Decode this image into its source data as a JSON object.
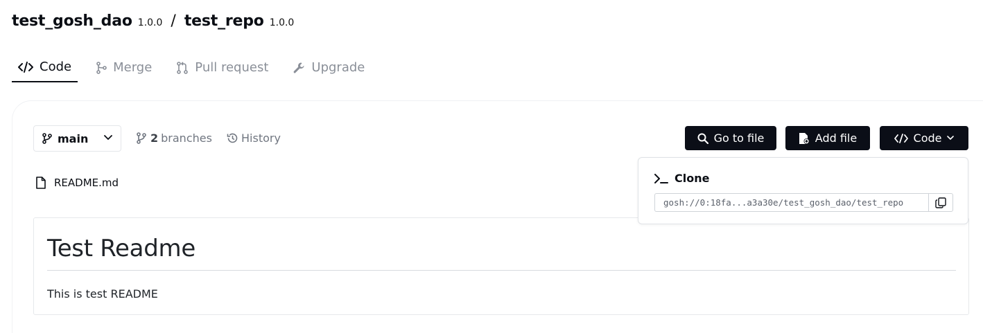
{
  "header": {
    "dao_name": "test_gosh_dao",
    "dao_version": "1.0.0",
    "separator": "/",
    "repo_name": "test_repo",
    "repo_version": "1.0.0"
  },
  "tabs": [
    {
      "label": "Code",
      "icon": "code-icon",
      "active": true
    },
    {
      "label": "Merge",
      "icon": "merge-icon",
      "active": false
    },
    {
      "label": "Pull request",
      "icon": "pull-request-icon",
      "active": false
    },
    {
      "label": "Upgrade",
      "icon": "wrench-icon",
      "active": false
    }
  ],
  "toolbar": {
    "branch_select": "main",
    "branches_count": "2",
    "branches_label": "branches",
    "history_label": "History",
    "go_to_file": "Go to file",
    "add_file": "Add file",
    "code": "Code"
  },
  "files": [
    {
      "name": "README.md",
      "icon": "file-icon"
    }
  ],
  "readme": {
    "heading": "Test Readme",
    "body": "This is test README"
  },
  "clone": {
    "title": "Clone",
    "url": "gosh://0:18fa...a3a30e/test_gosh_dao/test_repo"
  },
  "colors": {
    "primary_button": "#0b0e17",
    "active_text": "#0b0e14",
    "muted_text": "#8a8f98"
  }
}
